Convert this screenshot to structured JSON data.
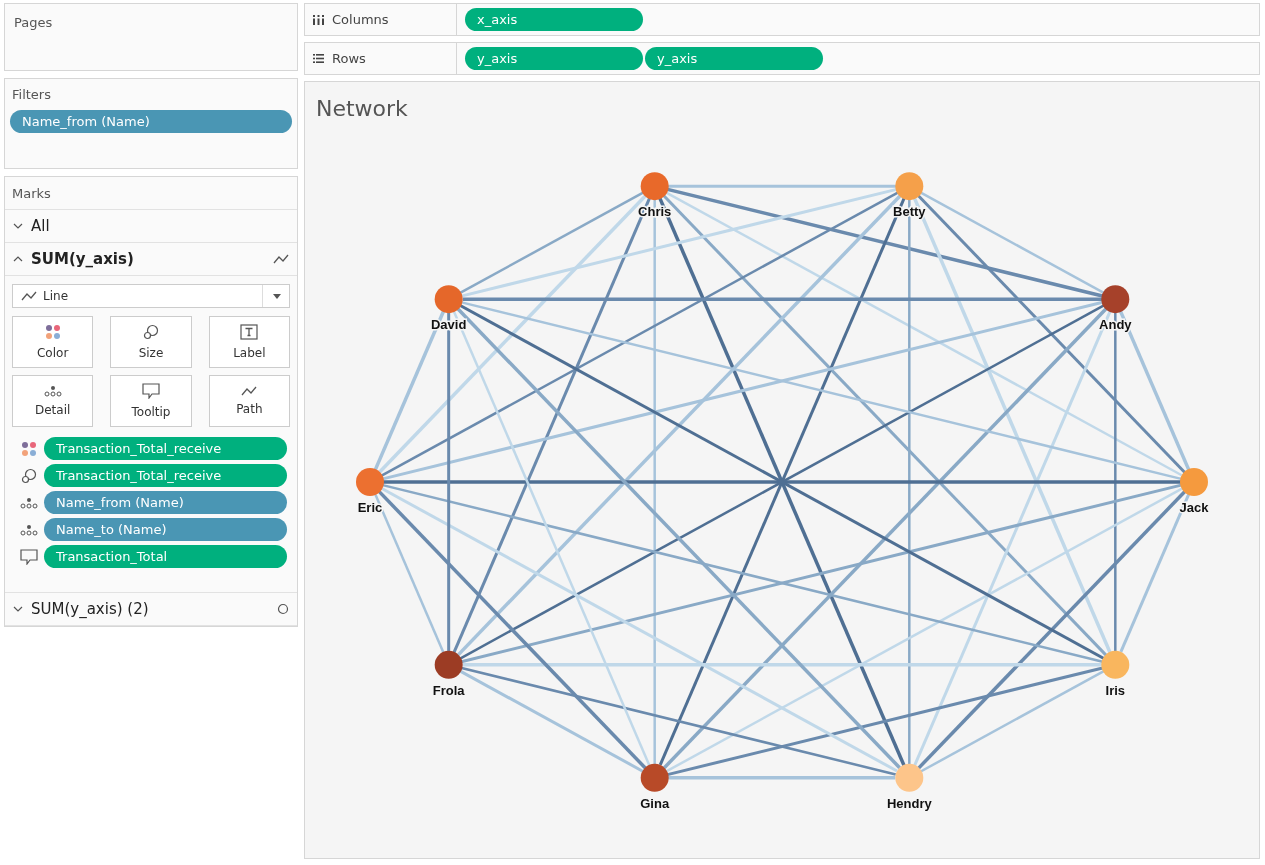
{
  "pages": {
    "title": "Pages"
  },
  "filters": {
    "title": "Filters",
    "pills": [
      {
        "label": "Name_from (Name)",
        "color": "#4a96b4"
      }
    ]
  },
  "marks": {
    "title": "Marks",
    "sections": [
      {
        "label": "All",
        "expanded": false,
        "kind": "all"
      },
      {
        "label": "SUM(y_axis)",
        "expanded": true,
        "kind": "line"
      },
      {
        "label": "SUM(y_axis) (2)",
        "expanded": false,
        "kind": "circle"
      }
    ],
    "mark_type": "Line",
    "cards": [
      {
        "kind": "color",
        "label": "Color"
      },
      {
        "kind": "size",
        "label": "Size"
      },
      {
        "kind": "label",
        "label": "Label"
      },
      {
        "kind": "detail",
        "label": "Detail"
      },
      {
        "kind": "tooltip",
        "label": "Tooltip"
      },
      {
        "kind": "path",
        "label": "Path"
      }
    ],
    "pills": [
      {
        "kind": "color",
        "label": "Transaction_Total_receive",
        "color": "#00b07e"
      },
      {
        "kind": "size",
        "label": "Transaction_Total_receive",
        "color": "#00b07e"
      },
      {
        "kind": "detail",
        "label": "Name_from (Name)",
        "color": "#4a96b4"
      },
      {
        "kind": "detail",
        "label": "Name_to (Name)",
        "color": "#4a96b4"
      },
      {
        "kind": "tooltip",
        "label": "Transaction_Total",
        "color": "#00b07e"
      }
    ]
  },
  "shelves": [
    {
      "kind": "columns",
      "label": "Columns",
      "pills": [
        {
          "label": "x_axis",
          "color": "#00b07e"
        }
      ]
    },
    {
      "kind": "rows",
      "label": "Rows",
      "pills": [
        {
          "label": "y_axis",
          "color": "#00b07e"
        },
        {
          "label": "y_axis",
          "color": "#00b07e"
        }
      ]
    }
  ],
  "view": {
    "title": "Network",
    "nodes": [
      {
        "name": "Chris",
        "color": "#e8692a"
      },
      {
        "name": "Betty",
        "color": "#f5a04a"
      },
      {
        "name": "Andy",
        "color": "#a6412a"
      },
      {
        "name": "Jack",
        "color": "#f59a3e"
      },
      {
        "name": "Iris",
        "color": "#f9b65e"
      },
      {
        "name": "Hendry",
        "color": "#fdc58a"
      },
      {
        "name": "Gina",
        "color": "#b84a28"
      },
      {
        "name": "Frola",
        "color": "#9c3c24"
      },
      {
        "name": "Eric",
        "color": "#ec7030"
      },
      {
        "name": "David",
        "color": "#e5672a"
      }
    ]
  }
}
